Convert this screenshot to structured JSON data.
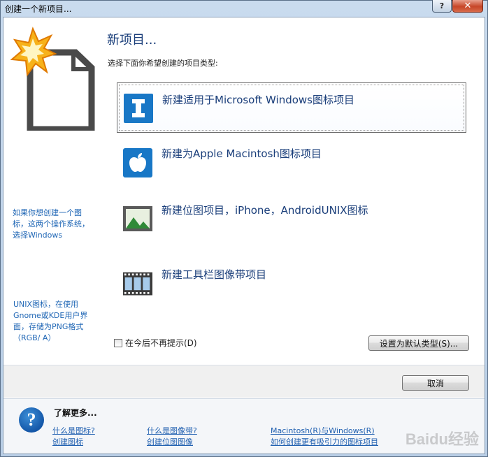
{
  "window": {
    "title": "创建一个新项目...",
    "help_btn": "?",
    "close_btn": "✕"
  },
  "header": {
    "heading": "新项目...",
    "subtitle": "选择下面你希望创建的项目类型:"
  },
  "options": [
    {
      "label": "新建适用于Microsoft Windows图标项目",
      "icon": "windows-icon-project-icon",
      "selected": true
    },
    {
      "label": "新建为Apple Macintosh图标项目",
      "icon": "apple-icon",
      "selected": false
    },
    {
      "label": "新建位图项目，iPhone，AndroidUNIX图标",
      "icon": "landscape-image-icon",
      "selected": false
    },
    {
      "label": "新建工具栏图像带项目",
      "icon": "film-strip-icon",
      "selected": false
    }
  ],
  "notes": {
    "note1": "如果你想创建一个图标，这两个操作系统，选择Windows",
    "note2": "UNIX图标，在使用Gnome或KDE用户界面，存储为PNG格式（RGB/ A）"
  },
  "controls": {
    "dont_show_label": "在今后不再提示(D)",
    "set_default_label": "设置为默认类型(S)...",
    "cancel_label": "取消"
  },
  "footer": {
    "title": "了解更多...",
    "links": [
      "什么是图标?",
      "创建图标",
      "什么是图像带?",
      "创建位图图像",
      "Macintosh(R)与Windows(R)",
      "如何创建更有吸引力的图标项目"
    ]
  },
  "colors": {
    "accent_text": "#1a3e7a",
    "link": "#1f5fb0",
    "icon_blue": "#1877c6",
    "image_green": "#2f8a37"
  },
  "watermark": "Baidu经验"
}
